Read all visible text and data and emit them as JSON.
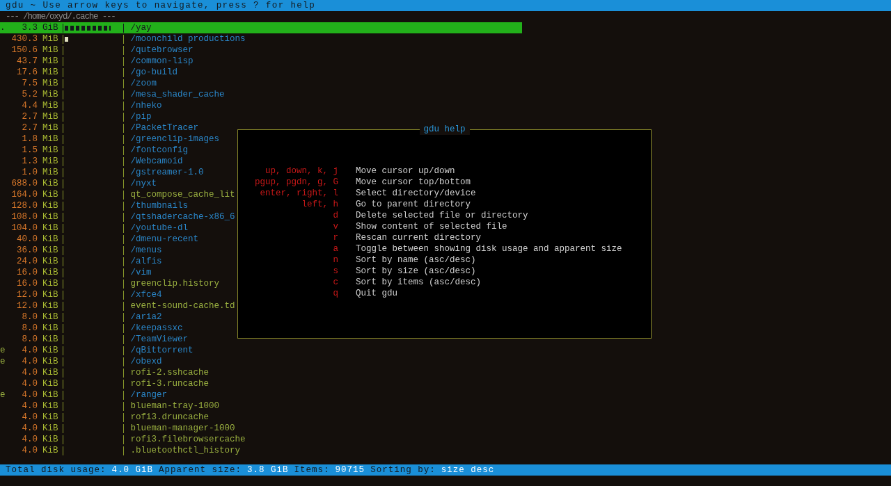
{
  "title_bar": {
    "text": "gdu ~ Use arrow keys to navigate, press ? for help"
  },
  "path": "--- /home/oxyd/.cache ---",
  "rows": [
    {
      "flag": ".",
      "size": "3.3",
      "unit": "GiB",
      "level": 0.8,
      "name": "/yay",
      "kind": "dir",
      "selected": true
    },
    {
      "size": "430.3",
      "unit": "MiB",
      "level": 0.1,
      "name": "/moonchild productions",
      "kind": "dir",
      "selected": false
    },
    {
      "size": "150.6",
      "unit": "MiB",
      "level": 0,
      "name": "/qutebrowser",
      "kind": "dir",
      "selected": false
    },
    {
      "size": "43.7",
      "unit": "MiB",
      "level": 0,
      "name": "/common-lisp",
      "kind": "dir",
      "selected": false
    },
    {
      "size": "17.6",
      "unit": "MiB",
      "level": 0,
      "name": "/go-build",
      "kind": "dir",
      "selected": false
    },
    {
      "size": "7.5",
      "unit": "MiB",
      "level": 0,
      "name": "/zoom",
      "kind": "dir",
      "selected": false
    },
    {
      "size": "5.2",
      "unit": "MiB",
      "level": 0,
      "name": "/mesa_shader_cache",
      "kind": "dir",
      "selected": false
    },
    {
      "size": "4.4",
      "unit": "MiB",
      "level": 0,
      "name": "/nheko",
      "kind": "dir",
      "selected": false
    },
    {
      "size": "2.7",
      "unit": "MiB",
      "level": 0,
      "name": "/pip",
      "kind": "dir",
      "selected": false
    },
    {
      "size": "2.7",
      "unit": "MiB",
      "level": 0,
      "name": "/PacketTracer",
      "kind": "dir",
      "selected": false
    },
    {
      "size": "1.8",
      "unit": "MiB",
      "level": 0,
      "name": "/greenclip-images",
      "kind": "dir",
      "selected": false
    },
    {
      "size": "1.5",
      "unit": "MiB",
      "level": 0,
      "name": "/fontconfig",
      "kind": "dir",
      "selected": false
    },
    {
      "size": "1.3",
      "unit": "MiB",
      "level": 0,
      "name": "/Webcamoid",
      "kind": "dir",
      "selected": false
    },
    {
      "size": "1.0",
      "unit": "MiB",
      "level": 0,
      "name": "/gstreamer-1.0",
      "kind": "dir",
      "selected": false
    },
    {
      "size": "688.0",
      "unit": "KiB",
      "level": 0,
      "name": "/nyxt",
      "kind": "dir",
      "selected": false
    },
    {
      "size": "164.0",
      "unit": "KiB",
      "level": 0,
      "name": "qt_compose_cache_lit",
      "kind": "file",
      "selected": false
    },
    {
      "size": "128.0",
      "unit": "KiB",
      "level": 0,
      "name": "/thumbnails",
      "kind": "dir",
      "selected": false
    },
    {
      "size": "108.0",
      "unit": "KiB",
      "level": 0,
      "name": "/qtshadercache-x86_6",
      "kind": "dir",
      "selected": false
    },
    {
      "size": "104.0",
      "unit": "KiB",
      "level": 0,
      "name": "/youtube-dl",
      "kind": "dir",
      "selected": false
    },
    {
      "size": "40.0",
      "unit": "KiB",
      "level": 0,
      "name": "/dmenu-recent",
      "kind": "dir",
      "selected": false
    },
    {
      "size": "36.0",
      "unit": "KiB",
      "level": 0,
      "name": "/menus",
      "kind": "dir",
      "selected": false
    },
    {
      "size": "24.0",
      "unit": "KiB",
      "level": 0,
      "name": "/alfis",
      "kind": "dir",
      "selected": false
    },
    {
      "size": "16.0",
      "unit": "KiB",
      "level": 0,
      "name": "/vim",
      "kind": "dir",
      "selected": false
    },
    {
      "size": "16.0",
      "unit": "KiB",
      "level": 0,
      "name": "greenclip.history",
      "kind": "file",
      "selected": false
    },
    {
      "size": "12.0",
      "unit": "KiB",
      "level": 0,
      "name": "/xfce4",
      "kind": "dir",
      "selected": false
    },
    {
      "size": "12.0",
      "unit": "KiB",
      "level": 0,
      "name": "event-sound-cache.td",
      "kind": "file",
      "selected": false
    },
    {
      "size": "8.0",
      "unit": "KiB",
      "level": 0,
      "name": "/aria2",
      "kind": "dir",
      "selected": false
    },
    {
      "size": "8.0",
      "unit": "KiB",
      "level": 0,
      "name": "/keepassxc",
      "kind": "dir",
      "selected": false
    },
    {
      "size": "8.0",
      "unit": "KiB",
      "level": 0,
      "name": "/TeamViewer",
      "kind": "dir",
      "selected": false
    },
    {
      "flag": "e",
      "size": "4.0",
      "unit": "KiB",
      "level": 0,
      "name": "/qBittorrent",
      "kind": "dir",
      "selected": false
    },
    {
      "flag": "e",
      "size": "4.0",
      "unit": "KiB",
      "level": 0,
      "name": "/obexd",
      "kind": "dir",
      "selected": false
    },
    {
      "size": "4.0",
      "unit": "KiB",
      "level": 0,
      "name": "rofi-2.sshcache",
      "kind": "file",
      "selected": false
    },
    {
      "size": "4.0",
      "unit": "KiB",
      "level": 0,
      "name": "rofi-3.runcache",
      "kind": "file",
      "selected": false
    },
    {
      "flag": "e",
      "size": "4.0",
      "unit": "KiB",
      "level": 0,
      "name": "/ranger",
      "kind": "dir",
      "selected": false
    },
    {
      "size": "4.0",
      "unit": "KiB",
      "level": 0,
      "name": "blueman-tray-1000",
      "kind": "file",
      "selected": false
    },
    {
      "size": "4.0",
      "unit": "KiB",
      "level": 0,
      "name": "rofi3.druncache",
      "kind": "file",
      "selected": false
    },
    {
      "size": "4.0",
      "unit": "KiB",
      "level": 0,
      "name": "blueman-manager-1000",
      "kind": "file",
      "selected": false
    },
    {
      "size": "4.0",
      "unit": "KiB",
      "level": 0,
      "name": "rofi3.filebrowsercache",
      "kind": "file",
      "selected": false
    },
    {
      "size": "4.0",
      "unit": "KiB",
      "level": 0,
      "name": ".bluetoothctl_history",
      "kind": "file",
      "selected": false
    }
  ],
  "help": {
    "title": "gdu help",
    "lines": [
      {
        "keys": "up, down, k, j",
        "description": "Move cursor up/down"
      },
      {
        "keys": "pgup, pgdn, g, G",
        "description": "Move cursor top/bottom"
      },
      {
        "keys": "enter, right, l",
        "description": "Select directory/device"
      },
      {
        "keys": "left, h",
        "description": "Go to parent directory"
      },
      {
        "keys": "d",
        "description": "Delete selected file or directory"
      },
      {
        "keys": "v",
        "description": "Show content of selected file"
      },
      {
        "keys": "r",
        "description": "Rescan current directory"
      },
      {
        "keys": "a",
        "description": "Toggle between showing disk usage and apparent size"
      },
      {
        "keys": "n",
        "description": "Sort by name (asc/desc)"
      },
      {
        "keys": "s",
        "description": "Sort by size (asc/desc)"
      },
      {
        "keys": "c",
        "description": "Sort by items (asc/desc)"
      },
      {
        "keys": "q",
        "description": "Quit gdu"
      }
    ]
  },
  "status_bar": [
    {
      "label": "Total disk usage:",
      "value": "4.0 GiB"
    },
    {
      "label": "Apparent size:",
      "value": "3.8 GiB"
    },
    {
      "label": "Items:",
      "value": "90715"
    },
    {
      "label": "Sorting by:",
      "value": "size desc"
    }
  ]
}
